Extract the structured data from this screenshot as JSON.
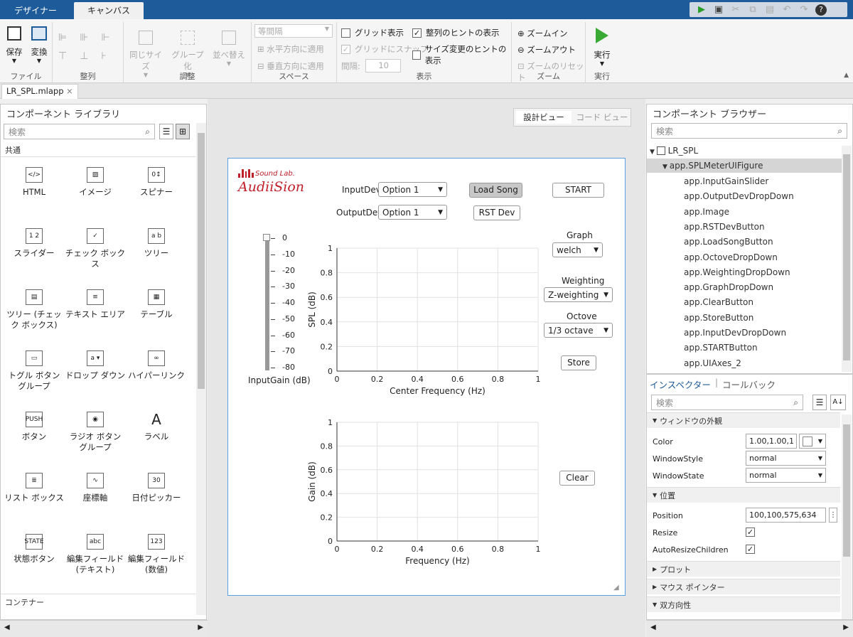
{
  "tabs": {
    "designer": "デザイナー",
    "canvas": "キャンバス"
  },
  "ribbon": {
    "save": "保存",
    "convert": "変換",
    "file_group": "ファイル",
    "align_group": "整列",
    "same_size": "同じサイズ",
    "group": "グループ化",
    "arrange": "並べ替え",
    "adjust_group": "調整",
    "spacing_select": "等間隔",
    "h_apply": "水平方向に適用",
    "v_apply": "垂直方向に適用",
    "space_group": "スペース",
    "grid_show": "グリッド表示",
    "grid_snap": "グリッドにスナップ",
    "interval_label": "間隔:",
    "interval_value": "10",
    "align_hint": "整列のヒントの表示",
    "resize_hint": "サイズ変更のヒントの表示",
    "display_group": "表示",
    "zoom_in": "ズームイン",
    "zoom_out": "ズームアウト",
    "zoom_reset": "ズームのリセット",
    "zoom_group": "ズーム",
    "run": "実行",
    "run_group": "実行"
  },
  "file_tab": "LR_SPL.mlapp",
  "library": {
    "title": "コンポーネント ライブラリ",
    "search_placeholder": "検索",
    "section_common": "共通",
    "section_container": "コンテナー",
    "items": [
      "HTML",
      "イメージ",
      "スピナー",
      "スライダー",
      "チェック ボックス",
      "ツリー",
      "ツリー (チェック ボックス)",
      "テキスト エリア",
      "テーブル",
      "トグル ボタン グループ",
      "ドロップ ダウン",
      "ハイパーリンク",
      "ボタン",
      "ラジオ ボタン グループ",
      "ラベル",
      "リスト ボックス",
      "座標軸",
      "日付ピッカー",
      "状態ボタン",
      "編集フィールド (テキスト)",
      "編集フィールド (数値)"
    ]
  },
  "view_toggle": {
    "design": "設計ビュー",
    "code": "コード ビュー"
  },
  "app": {
    "logo_small": "Sound Lab.",
    "logo_big": "AudiiSion",
    "inputdev_label": "InputDev",
    "outputdev_label": "OutputDev",
    "option1": "Option 1",
    "option2": "Option 1",
    "load_song": "Load Song",
    "start": "START",
    "rst_dev": "RST Dev",
    "graph_label": "Graph",
    "graph_value": "welch",
    "weighting_label": "Weighting",
    "weighting_value": "Z-weighting",
    "octave_label": "Octove",
    "octave_value": "1/3 octave",
    "store": "Store",
    "clear": "Clear",
    "gain_label": "InputGain (dB)",
    "gain_ticks": [
      "0",
      "-10",
      "-20",
      "-30",
      "-40",
      "-50",
      "-60",
      "-70",
      "-80"
    ]
  },
  "chart_data": [
    {
      "type": "line",
      "title": "",
      "xlabel": "Center Frequency (Hz)",
      "ylabel": "SPL (dB)",
      "xlim": [
        0,
        1
      ],
      "ylim": [
        0,
        1
      ],
      "xticks": [
        "0",
        "0.2",
        "0.4",
        "0.6",
        "0.8",
        "1"
      ],
      "yticks": [
        "0",
        "0.2",
        "0.4",
        "0.6",
        "0.8",
        "1"
      ],
      "grid": true,
      "series": []
    },
    {
      "type": "line",
      "title": "",
      "xlabel": "Frequency (Hz)",
      "ylabel": "Gain (dB)",
      "xlim": [
        0,
        1
      ],
      "ylim": [
        0,
        1
      ],
      "xticks": [
        "0",
        "0.2",
        "0.4",
        "0.6",
        "0.8",
        "1"
      ],
      "yticks": [
        "0",
        "0.2",
        "0.4",
        "0.6",
        "0.8",
        "1"
      ],
      "grid": true,
      "series": []
    }
  ],
  "browser": {
    "title": "コンポーネント ブラウザー",
    "search_placeholder": "検索",
    "root": "LR_SPL",
    "figure": "app.SPLMeterUIFigure",
    "items": [
      "app.InputGainSlider",
      "app.OutputDevDropDown",
      "app.Image",
      "app.RSTDevButton",
      "app.LoadSongButton",
      "app.OctoveDropDown",
      "app.WeightingDropDown",
      "app.GraphDropDown",
      "app.ClearButton",
      "app.StoreButton",
      "app.InputDevDropDown",
      "app.STARTButton",
      "app.UIAxes_2"
    ]
  },
  "inspector": {
    "tab_inspector": "インスペクター",
    "tab_callback": "コールバック",
    "search_placeholder": "検索",
    "sec_window": "ウィンドウの外観",
    "color_label": "Color",
    "color_value": "1.00,1.00,1",
    "winstyle_label": "WindowStyle",
    "winstyle_value": "normal",
    "winstate_label": "WindowState",
    "winstate_value": "normal",
    "sec_position": "位置",
    "position_label": "Position",
    "position_value": "100,100,575,634",
    "resize_label": "Resize",
    "autoresize_label": "AutoResizeChildren",
    "sec_plot": "プロット",
    "sec_mouse": "マウス ポインター",
    "sec_interactive": "双方向性"
  }
}
